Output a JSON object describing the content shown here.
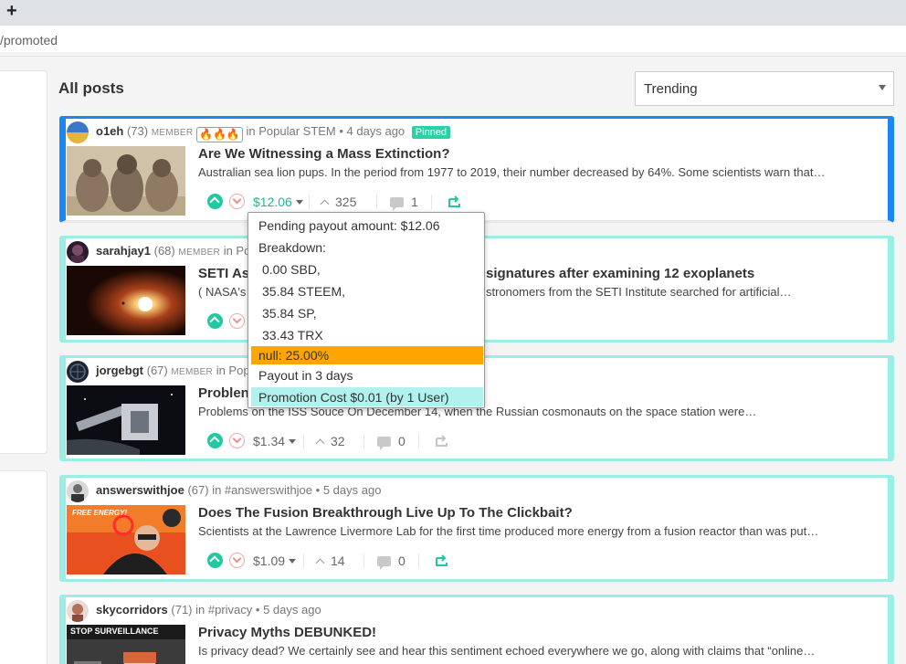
{
  "browser": {
    "new_tab_label": "+",
    "url": "/promoted"
  },
  "feed": {
    "heading": "All posts",
    "sort": {
      "selected": "Trending"
    }
  },
  "posts": [
    {
      "author": "o1eh",
      "reputation": "(73)",
      "member": "MEMBER",
      "badge": "🔥🔥🔥",
      "community": "in Popular STEM",
      "age": "• 4 days ago",
      "pinned_label": "Pinned",
      "title": "Are We Witnessing a Mass Extinction?",
      "body": "Australian sea lion pups. In the period from 1977 to 2019, their number decreased by 64%. Some scientists warn that…",
      "payout": "$12.06",
      "votes": "325",
      "comments": "1"
    },
    {
      "author": "sarahjay1",
      "reputation": "(68)",
      "member": "MEMBER",
      "community": "in Popu",
      "title": "SETI As",
      "title_tail": "signatures after examining 12 exoplanets",
      "body": "( NASA's C",
      "body_tail": "stronomers from the SETI Institute searched for artificial…"
    },
    {
      "author": "jorgebgt",
      "reputation": "(67)",
      "member": "MEMBER",
      "community": "in Popu",
      "title": "Problen",
      "body": "Problems on the ISS Souce On December 14, when the Russian cosmonauts on the space station were…",
      "payout": "$1.34",
      "votes": "32",
      "comments": "0"
    },
    {
      "author": "answerswithjoe",
      "reputation": "(67)",
      "community": "in #answerswithjoe",
      "age": "• 5 days ago",
      "title": "Does The Fusion Breakthrough Live Up To The Clickbait?",
      "body": "Scientists at the Lawrence Livermore Lab for the first time produced more energy from a fusion reactor than was put…",
      "payout": "$1.09",
      "votes": "14",
      "comments": "0",
      "thumb_caption": "FREE ENERGY!"
    },
    {
      "author": "skycorridors",
      "reputation": "(71)",
      "community": "in #privacy",
      "age": "• 5 days ago",
      "title": "Privacy Myths DEBUNKED!",
      "body": "Is privacy dead? We certainly see and hear this sentiment echoed everywhere we go, along with claims that “online…",
      "thumb_caption": "STOP SURVEILLANCE"
    }
  ],
  "payout_popup": {
    "pending": "Pending payout amount: $12.06",
    "breakdown_label": "Breakdown:",
    "breakdown": [
      "0.00 SBD,",
      "35.84 STEEM,",
      "35.84 SP,",
      "33.43 TRX"
    ],
    "beneficiary": "null: 25.00%",
    "payout_in": "Payout in 3 days",
    "promotion": "Promotion Cost $0.01 (by 1 User)"
  },
  "colors": {
    "accent_green": "#20c9a0",
    "pinned_blue": "#1a87f5",
    "card_border": "#9beee6",
    "null_highlight": "#ffa500",
    "promo_highlight": "#b2f2ee"
  }
}
